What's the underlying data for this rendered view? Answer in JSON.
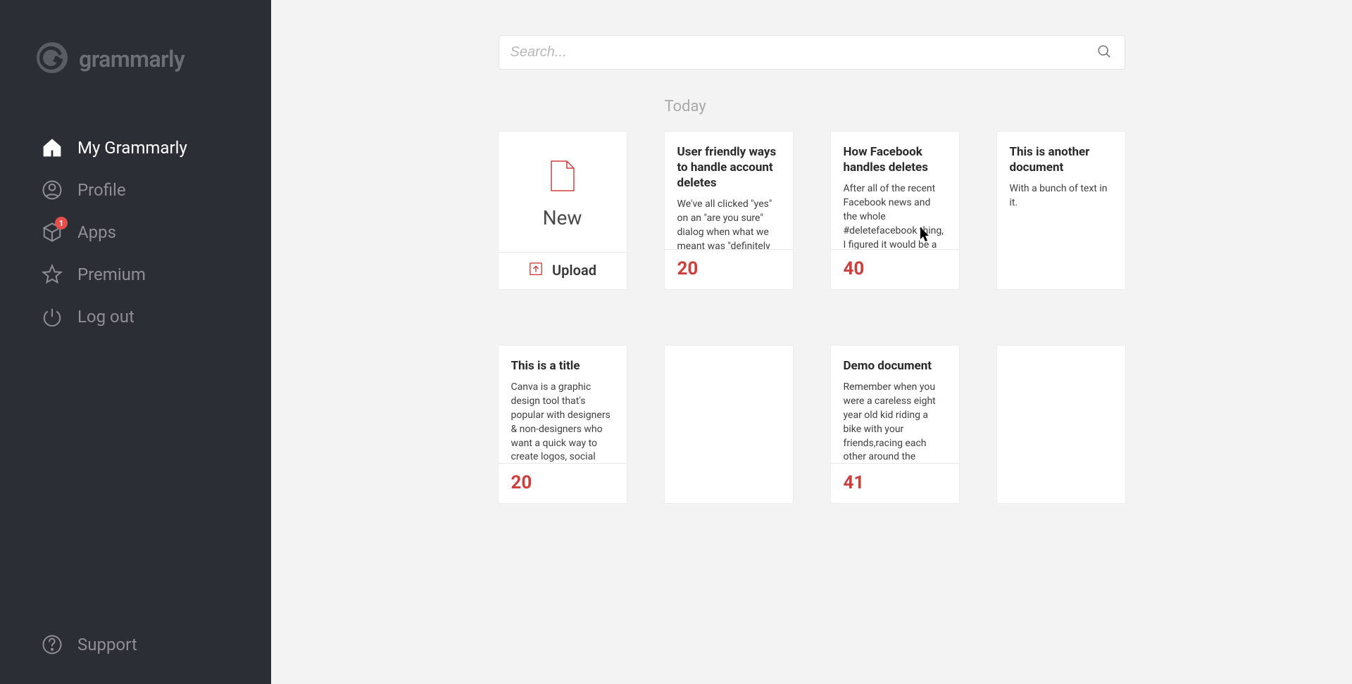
{
  "brand": {
    "name": "grammarly"
  },
  "sidebar": {
    "items": [
      {
        "label": "My Grammarly"
      },
      {
        "label": "Profile"
      },
      {
        "label": "Apps",
        "badge": "1"
      },
      {
        "label": "Premium"
      },
      {
        "label": "Log out"
      }
    ],
    "support": {
      "label": "Support"
    }
  },
  "search": {
    "placeholder": "Search..."
  },
  "section_title": "Today",
  "new_card": {
    "label": "New",
    "upload": "Upload"
  },
  "docs": [
    {
      "title": "User friendly ways to handle account deletes",
      "excerpt": "We've all clicked \"yes\" on an \"are you sure\" dialog when what we meant was \"definitely",
      "count": "20"
    },
    {
      "title": "How Facebook handles deletes",
      "excerpt": "After all of the recent Facebook news and the whole #deletefacebook thing, I figured it would be a good time to see",
      "count": "40"
    },
    {
      "title": "This is another document",
      "excerpt": "With a bunch of text in it.",
      "count": ""
    },
    {
      "title": "This is a title",
      "excerpt": "Canva is a graphic design tool that's popular with designers & non-designers who want a quick way to create logos, social",
      "count": "20"
    },
    {
      "title": "",
      "excerpt": "",
      "count": ""
    },
    {
      "title": "Demo document",
      "excerpt": "Remember when you were a careless eight year old kid riding a bike with your friends,racing each other around the",
      "count": "41"
    },
    {
      "title": "",
      "excerpt": "",
      "count": ""
    }
  ]
}
